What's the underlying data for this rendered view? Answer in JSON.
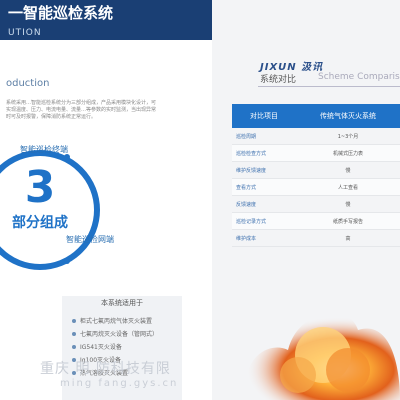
{
  "left_page": {
    "title": "一智能巡检系统",
    "subtitle": "UTION",
    "intro_heading": "oduction",
    "intro_text": "系统采用…智能巡检系统分为三部分组成，产品采用模块化设计，可实现温度、压力、电流电量、流量…等参数的实时监测，当出现异常时可及时报警，保障消防系统正常运行。",
    "big_number": "3",
    "big_label": "部分组成",
    "orbit_top": "智能巡检终端",
    "orbit_bottom": "智能巡检网端",
    "applies_heading": "本系统适用于",
    "applies_list": [
      "柜式七氟丙烷气体灭火装置",
      "七氟丙烷灭火设备（管网式）",
      "IG541灭火设备",
      "Ig100灭火设备",
      "热气溶胶灭火装置"
    ],
    "watermark_cn": "重庆 明 防科技有限",
    "watermark_url": "ming fang.gys.cn"
  },
  "right_page": {
    "brand": "JIXUN 汲讯",
    "title": "系统对比",
    "title_en": "Scheme Comparis",
    "table": {
      "headers": [
        "对比项目",
        "传统气体灭火系统"
      ],
      "rows": [
        [
          "巡检周期",
          "1~3个月"
        ],
        [
          "巡检检查方式",
          "机械式压力表"
        ],
        [
          "维护反馈速度",
          "慢"
        ],
        [
          "查看方式",
          "人工查看"
        ],
        [
          "反馈速度",
          "慢"
        ],
        [
          "巡检记录方式",
          "纸质手写报告"
        ],
        [
          "维护成本",
          "高"
        ]
      ]
    }
  },
  "colors": {
    "brand_navy": "#1a3f74",
    "accent_blue": "#1f72c7"
  }
}
